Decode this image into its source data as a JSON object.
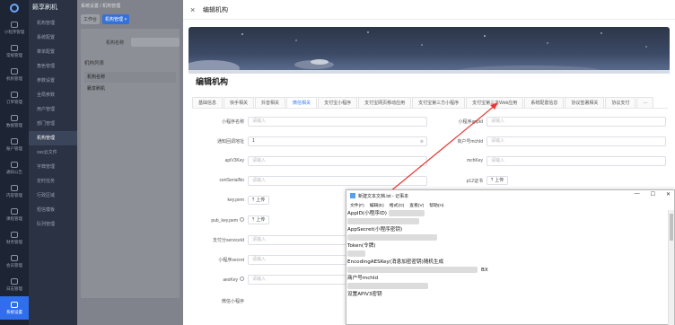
{
  "sidebar": {
    "items": [
      {
        "label": "小程序管理",
        "icon": "grid-icon"
      },
      {
        "label": "常规管理",
        "icon": "home-icon"
      },
      {
        "label": "机构管理",
        "icon": "bank-icon"
      },
      {
        "label": "订单管理",
        "icon": "order-icon"
      },
      {
        "label": "数据管理",
        "icon": "chart-icon"
      },
      {
        "label": "账户管理",
        "icon": "user-icon"
      },
      {
        "label": "通知公告",
        "icon": "bell-icon"
      },
      {
        "label": "内容管理",
        "icon": "doc-icon"
      },
      {
        "label": "课程管理",
        "icon": "book-icon"
      },
      {
        "label": "财务管理",
        "icon": "wallet-icon"
      },
      {
        "label": "会员管理",
        "icon": "vip-icon"
      },
      {
        "label": "日志管理",
        "icon": "log-icon"
      },
      {
        "label": "系统设置",
        "icon": "gear-icon",
        "active": true
      }
    ]
  },
  "subnav": {
    "app_title": "籁享刷机",
    "items": [
      {
        "label": "机构管理"
      },
      {
        "label": "系统配置"
      },
      {
        "label": "菜单配置"
      },
      {
        "label": "角色管理"
      },
      {
        "label": "参数设置"
      },
      {
        "label": "全局参数"
      },
      {
        "label": "用户管理"
      },
      {
        "label": "部门管理"
      },
      {
        "label": "机构管理",
        "active": true
      },
      {
        "label": "oss云文件"
      },
      {
        "label": "字典管理"
      },
      {
        "label": "定时任务"
      },
      {
        "label": "行政区域"
      },
      {
        "label": "短信模板"
      },
      {
        "label": "队列管理"
      }
    ]
  },
  "bgpage": {
    "breadcrumb": "系统设置 / 机构管理",
    "tabs": [
      "工作台",
      "机构管理 ×"
    ],
    "search_label": "机构名称",
    "list_title": "机构列表",
    "table_header": "机构名称",
    "row": "籁享刷机"
  },
  "drawer": {
    "close": "×",
    "title": "编辑机构",
    "section_title": "编辑机构",
    "tabs": [
      {
        "label": "基础信息"
      },
      {
        "label": "快手相关"
      },
      {
        "label": "抖音相关"
      },
      {
        "label": "微信相关",
        "active": true
      },
      {
        "label": "支付宝小程序"
      },
      {
        "label": "支付宝网页移动应用"
      },
      {
        "label": "支付宝第三方小程序"
      },
      {
        "label": "支付宝第三方Web应用"
      },
      {
        "label": "系统配置信息"
      },
      {
        "label": "协议签署相关"
      },
      {
        "label": "协议支付"
      }
    ],
    "more": "···",
    "form": {
      "miniapp_name_label": "小程序名称",
      "miniapp_name_ph": "请输入",
      "miniapp_appid_label": "小程序appId",
      "miniapp_appid_ph": "请输入",
      "notify_url_label": "通知回调地址",
      "notify_url_value": "1",
      "mchid_label": "商户号mchId",
      "mchid_ph": "请输入",
      "apiv3_label": "apiV3Key",
      "apiv3_ph": "请输入",
      "mchkey_label": "mchKey",
      "mchkey_ph": "请输入",
      "cert_serial_label": "certSerialNo",
      "cert_serial_ph": "请输入",
      "p12_label": "p12证书",
      "upload_label": "上传",
      "keypem_label": "key.pem",
      "pubkey_label": "pub_key.pem",
      "service_id_label": "支付分serviceId",
      "service_id_ph": "请输入",
      "miniapp_secret_label": "小程序secret",
      "miniapp_secret_ph": "请输入",
      "aeskey_label": "aesKey",
      "aeskey_ph": "请输入",
      "more_label": "微信小程序"
    }
  },
  "notepad": {
    "title": "新建文本文档.txt - 记事本",
    "controls": [
      "—",
      "☐",
      "✕"
    ],
    "menu": [
      "文件(F)",
      "编辑(E)",
      "格式(O)",
      "查看(V)",
      "帮助(H)"
    ],
    "lines": [
      "AppID(小程序ID)",
      "AppSecret(小程序密钥)",
      "Token(令牌)",
      "EncodingAESKey(消息加密密钥)随机生成",
      "BX",
      "商户号mchId",
      "设置APIV3密钥"
    ]
  },
  "colors": {
    "primary": "#2f7bf5",
    "sidebar_bg": "#1d2433",
    "sidebar_active": "#2f6fed",
    "arrow": "#e53935"
  }
}
